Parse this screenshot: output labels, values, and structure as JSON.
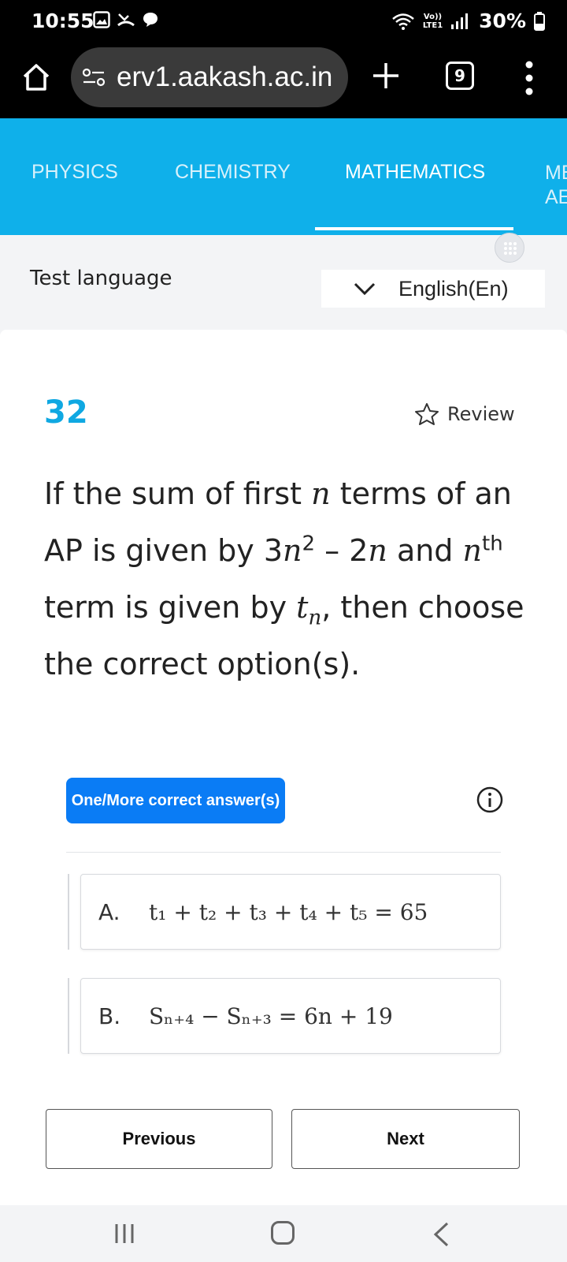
{
  "status": {
    "time": "10:55",
    "lte_top": "Vo))",
    "lte_bottom": "LTE1",
    "battery": "30%"
  },
  "browser": {
    "url": "erv1.aakash.ac.in",
    "tab_count": "9"
  },
  "subjects": {
    "tabs": [
      "PHYSICS",
      "CHEMISTRY",
      "MATHEMATICS"
    ],
    "more_line1": "ME",
    "more_line2": "AE",
    "active": "MATHEMATICS"
  },
  "language": {
    "label": "Test language",
    "value": "English(En)"
  },
  "question": {
    "number": "32",
    "review_label": "Review",
    "text_part1": "If the sum of first ",
    "var_n": "n",
    "text_part2": " terms of an AP is given by 3",
    "sup_2": "2",
    "text_part3": " – 2",
    "text_part4": " and ",
    "sup_th": "th",
    "text_part5": " term is given by ",
    "var_t": "t",
    "text_part6": ", then choose the correct option(s).",
    "type_badge": "One/More correct answer(s)"
  },
  "options": [
    {
      "letter": "A.",
      "math": "t₁ + t₂ + t₃ + t₄ + t₅ = 65"
    },
    {
      "letter": "B.",
      "math": "Sₙ₊₄ − Sₙ₊₃ = 6n + 19"
    }
  ],
  "nav": {
    "previous": "Previous",
    "next": "Next"
  }
}
